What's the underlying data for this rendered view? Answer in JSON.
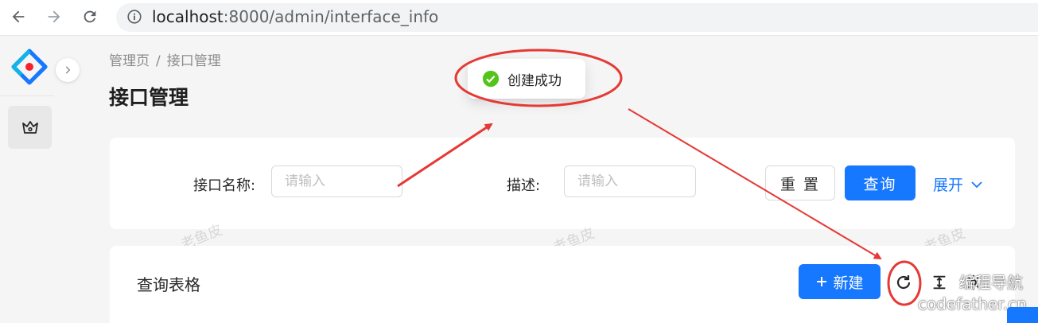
{
  "browser": {
    "url_host": "localhost",
    "url_path": ":8000/admin/interface_info"
  },
  "breadcrumb": {
    "items": [
      "管理页",
      "接口管理"
    ],
    "separator": "/"
  },
  "page": {
    "title": "接口管理"
  },
  "search_form": {
    "name_label": "接口名称:",
    "name_placeholder": "请输入",
    "desc_label": "描述:",
    "desc_placeholder": "请输入",
    "reset_label": "重 置",
    "query_label": "查询",
    "expand_label": "展开"
  },
  "table": {
    "title": "查询表格",
    "new_label": "新建"
  },
  "toast": {
    "message": "创建成功",
    "type": "success"
  },
  "watermarks": [
    "老鱼皮",
    "老鱼皮",
    "老鱼皮"
  ],
  "corner_watermark": {
    "line1": "编程导航",
    "line2": "codefather.cn"
  },
  "colors": {
    "primary": "#1677ff",
    "success": "#52c41a",
    "annotation": "#e53935"
  },
  "icons": {
    "back": "arrow-left-icon",
    "forward": "arrow-right-icon",
    "reload": "reload-icon",
    "site_info": "info-circle-icon",
    "logo": "app-logo",
    "collapse": "chevron-right-icon",
    "admin": "crown-icon",
    "expand": "chevron-down-icon",
    "success": "check-circle-icon",
    "refresh": "refresh-icon",
    "density": "column-height-icon",
    "settings": "setting-icon"
  }
}
